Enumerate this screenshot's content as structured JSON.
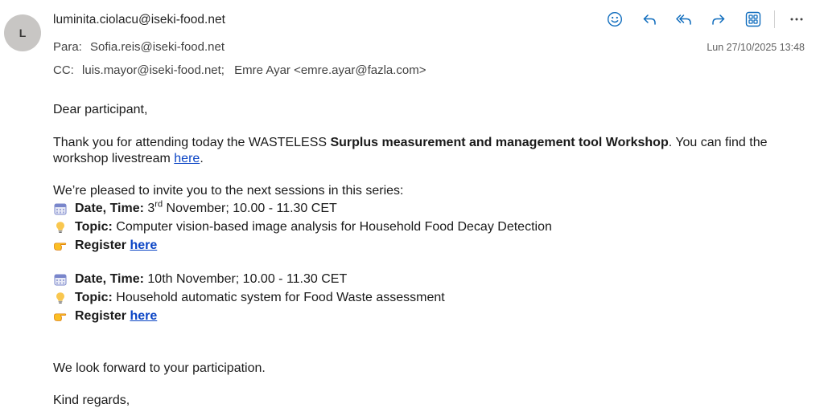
{
  "header": {
    "avatar_initial": "L",
    "sender": "luminita.ciolacu@iseki-food.net",
    "to_label": "Para:",
    "to": "Sofia.reis@iseki-food.net",
    "cc_label": "CC:",
    "cc_1": "luis.mayor@iseki-food.net;",
    "cc_2": "Emre Ayar <emre.ayar@fazla.com>",
    "datetime": "Lun 27/10/2025 13:48"
  },
  "toolbar": {
    "icons": [
      "emoji-icon",
      "reply-icon",
      "reply-all-icon",
      "forward-icon",
      "apps-icon",
      "more-icon"
    ],
    "accent_color": "#0f6cbd"
  },
  "body": {
    "greeting": "Dear participant,",
    "thanks_pre": "Thank you for attending today the WASTELESS ",
    "thanks_bold": "Surplus measurement and management tool Workshop",
    "thanks_post": ". You can find the",
    "livestream_pre": "workshop livestream ",
    "livestream_link": "here",
    "livestream_post": ".",
    "invite": "We’re pleased to invite you to the next sessions in this series:",
    "sessions": [
      {
        "date_label": "Date, Time:",
        "date_day": " 3",
        "date_sup": "rd",
        "date_rest": " November; 10.00 - 11.30 CET",
        "topic_label": "Topic:",
        "topic": " Computer vision-based image analysis for Household Food Decay Detection",
        "register_label": "Register ",
        "register_link": "here"
      },
      {
        "date_label": "Date, Time:",
        "date_day": " 10th November; 10.00 - 11.30 CET",
        "date_sup": "",
        "date_rest": "",
        "topic_label": "Topic:",
        "topic": " Household automatic system for Food Waste assessment",
        "register_label": "Register ",
        "register_link": "here"
      }
    ],
    "closing": "We look forward to your participation.",
    "signoff": "Kind regards,"
  }
}
